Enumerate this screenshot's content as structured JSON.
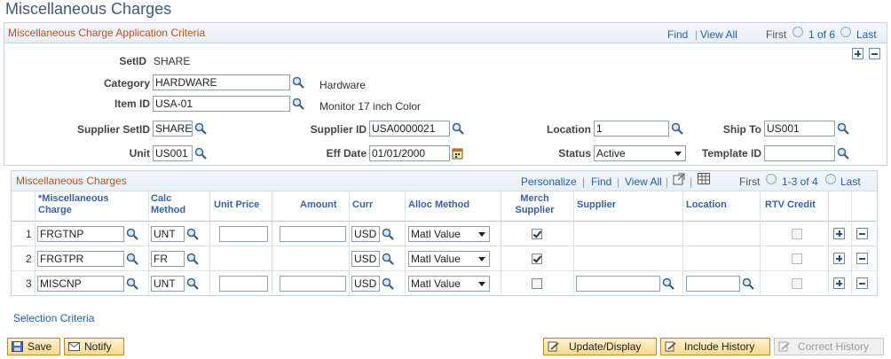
{
  "page": {
    "title": "Miscellaneous Charges"
  },
  "criteria": {
    "title": "Miscellaneous Charge Application Criteria",
    "find": "Find",
    "view_all": "View All",
    "first": "First",
    "count": "1 of 6",
    "last": "Last",
    "setid_label": "SetID",
    "setid_value": "SHARE",
    "category_label": "Category",
    "category_value": "HARDWARE",
    "category_desc": "Hardware",
    "item_label": "Item ID",
    "item_value": "USA-01",
    "item_desc": "Monitor  17 inch Color",
    "supplier_setid_label": "Supplier SetID",
    "supplier_setid_value": "SHARE",
    "supplier_id_label": "Supplier ID",
    "supplier_id_value": "USA0000021",
    "location_label": "Location",
    "location_value": "1",
    "shipto_label": "Ship To",
    "shipto_value": "US001",
    "unit_label": "Unit",
    "unit_value": "US001",
    "effdate_label": "Eff Date",
    "effdate_value": "01/01/2000",
    "status_label": "Status",
    "status_value": "Active",
    "template_label": "Template ID",
    "template_value": ""
  },
  "grid": {
    "title": "Miscellaneous Charges",
    "personalize": "Personalize",
    "find": "Find",
    "view_all": "View All",
    "first": "First",
    "count": "1-3 of 4",
    "last": "Last",
    "columns": {
      "charge": "*Miscellaneous Charge",
      "calc": "Calc Method",
      "unit_price": "Unit Price",
      "amount": "Amount",
      "curr": "Curr",
      "alloc": "Alloc Method",
      "merch": "Merch Supplier",
      "supplier": "Supplier",
      "location": "Location",
      "rtv": "RTV Credit"
    },
    "rows": [
      {
        "num": "1",
        "charge": "FRGTNP",
        "calc": "UNT",
        "unit_price": "",
        "amount": "",
        "curr": "USD",
        "alloc": "Matl Value",
        "merch": true,
        "rtv": false
      },
      {
        "num": "2",
        "charge": "FRGTPR",
        "calc": "FR",
        "unit_price": "",
        "amount": "",
        "curr": "USD",
        "alloc": "Matl Value",
        "merch": true,
        "rtv": false
      },
      {
        "num": "3",
        "charge": "MISCNP",
        "calc": "UNT",
        "unit_price": "",
        "amount": "",
        "curr": "USD",
        "alloc": "Matl Value",
        "merch": false,
        "rtv": false
      }
    ]
  },
  "footer": {
    "selection_criteria": "Selection Criteria",
    "save": "Save",
    "notify": "Notify",
    "update_display": "Update/Display",
    "include_history": "Include History",
    "correct_history": "Correct History"
  }
}
